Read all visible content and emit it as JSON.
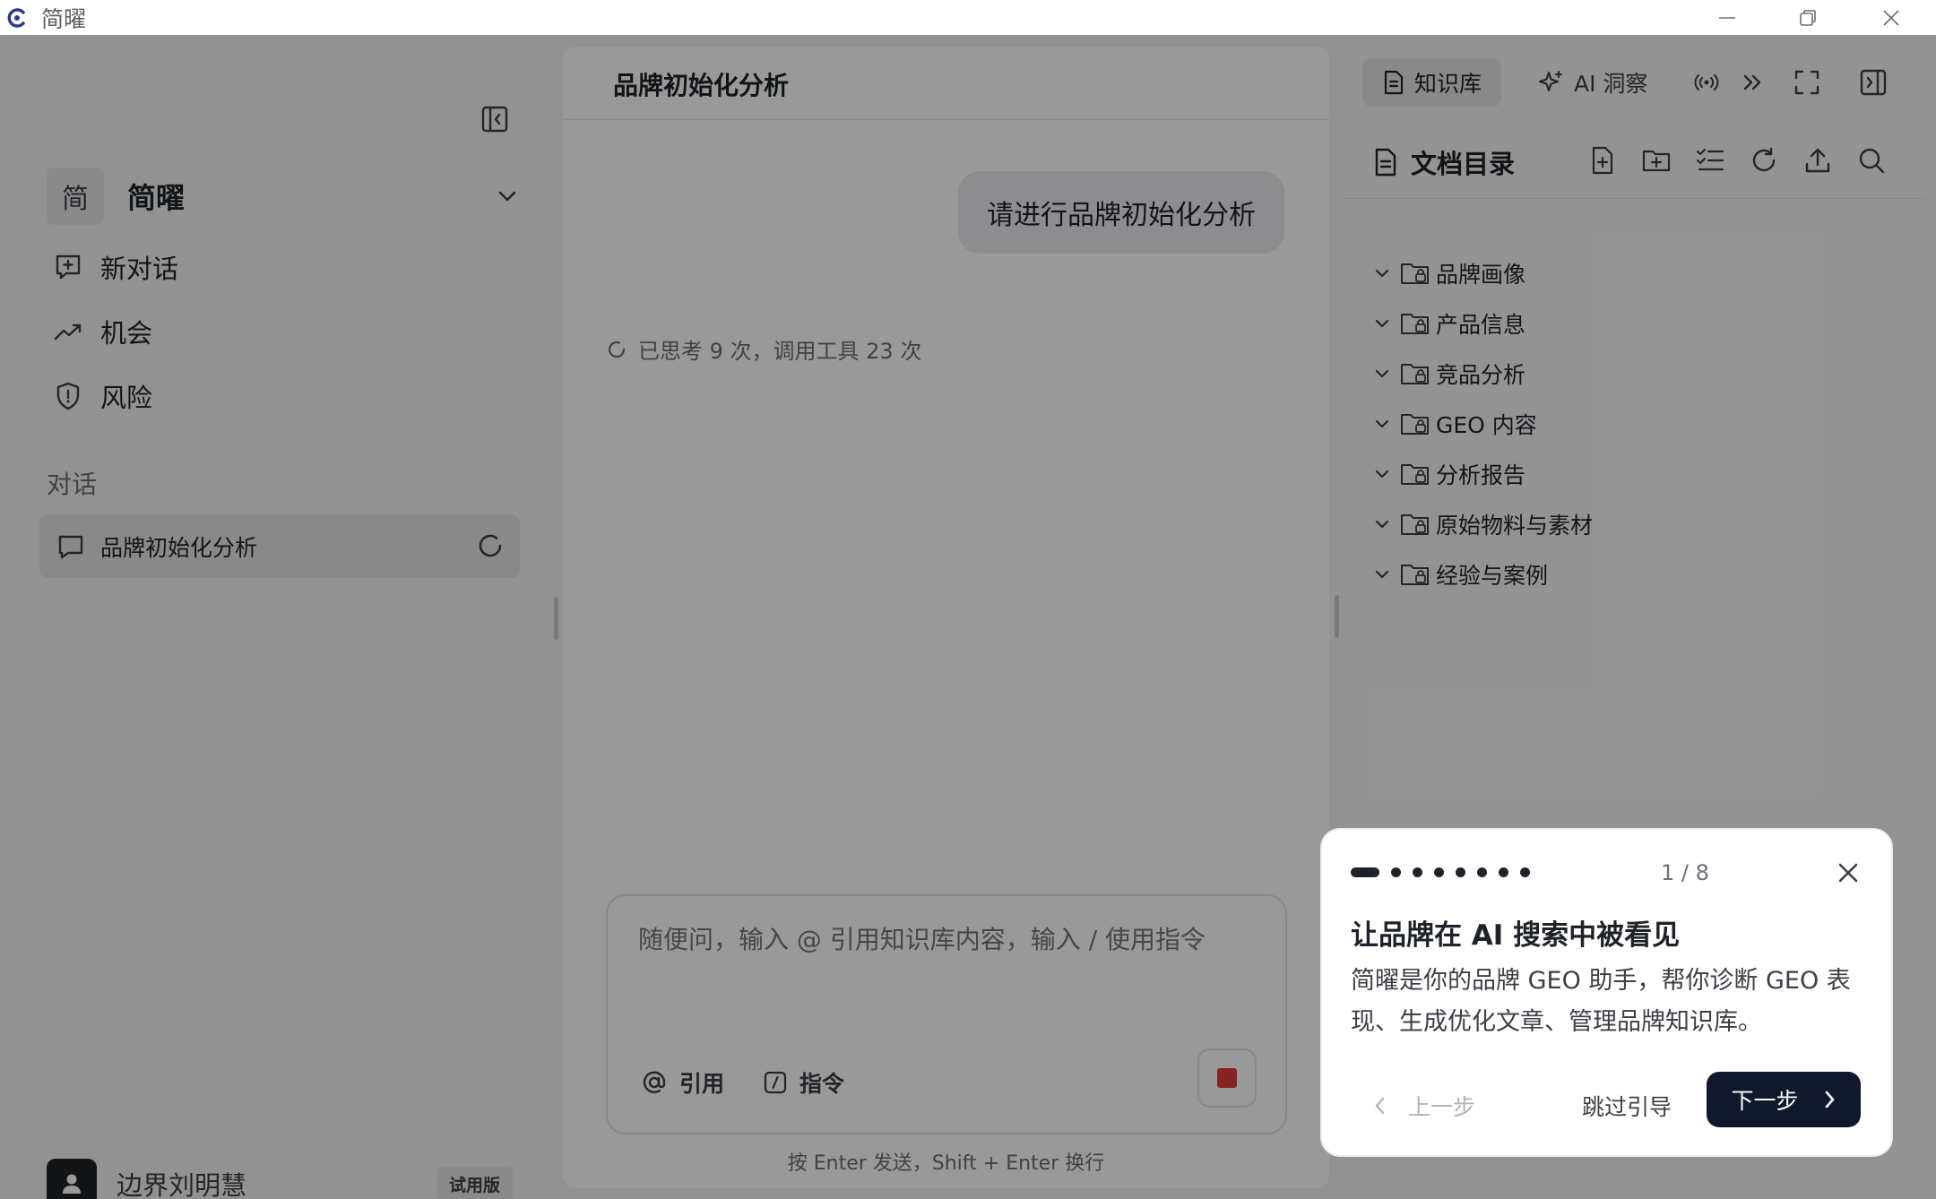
{
  "window": {
    "title": "简曜"
  },
  "sidebar": {
    "brand_avatar": "简",
    "brand_name": "简曜",
    "nav": [
      {
        "label": "新对话",
        "icon": "new-chat-icon"
      },
      {
        "label": "机会",
        "icon": "trend-up-icon"
      },
      {
        "label": "风险",
        "icon": "shield-alert-icon"
      }
    ],
    "section_title": "对话",
    "conversations": [
      {
        "label": "品牌初始化分析",
        "status": "loading"
      }
    ],
    "user": {
      "name": "边界刘明慧",
      "badge": "试用版"
    }
  },
  "chat": {
    "title": "品牌初始化分析",
    "user_message": "请进行品牌初始化分析",
    "status": "已思考 9 次，调用工具 23 次",
    "composer": {
      "placeholder": "随便问，输入 @ 引用知识库内容，输入 / 使用指令",
      "cite_label": "引用",
      "command_label": "指令",
      "hint": "按 Enter 发送，Shift + Enter 换行"
    }
  },
  "right_panel": {
    "tabs": [
      {
        "label": "知识库",
        "active": true
      },
      {
        "label": "AI 洞察",
        "active": false
      }
    ],
    "doc_title": "文档目录",
    "tree": [
      "品牌画像",
      "产品信息",
      "竞品分析",
      "GEO 内容",
      "分析报告",
      "原始物料与素材",
      "经验与案例"
    ]
  },
  "tour": {
    "step": "1 / 8",
    "total_steps": 8,
    "current_step": 1,
    "title": "让品牌在 AI 搜索中被看见",
    "description": "简曜是你的品牌 GEO 助手，帮你诊断 GEO 表现、生成优化文章、管理品牌知识库。",
    "prev_label": "上一步",
    "skip_label": "跳过引导",
    "next_label": "下一步"
  },
  "colors": {
    "accent_dark": "#11182b",
    "stop_red": "#e23b3b",
    "overlay": "rgba(0,0,0,0.4)"
  }
}
